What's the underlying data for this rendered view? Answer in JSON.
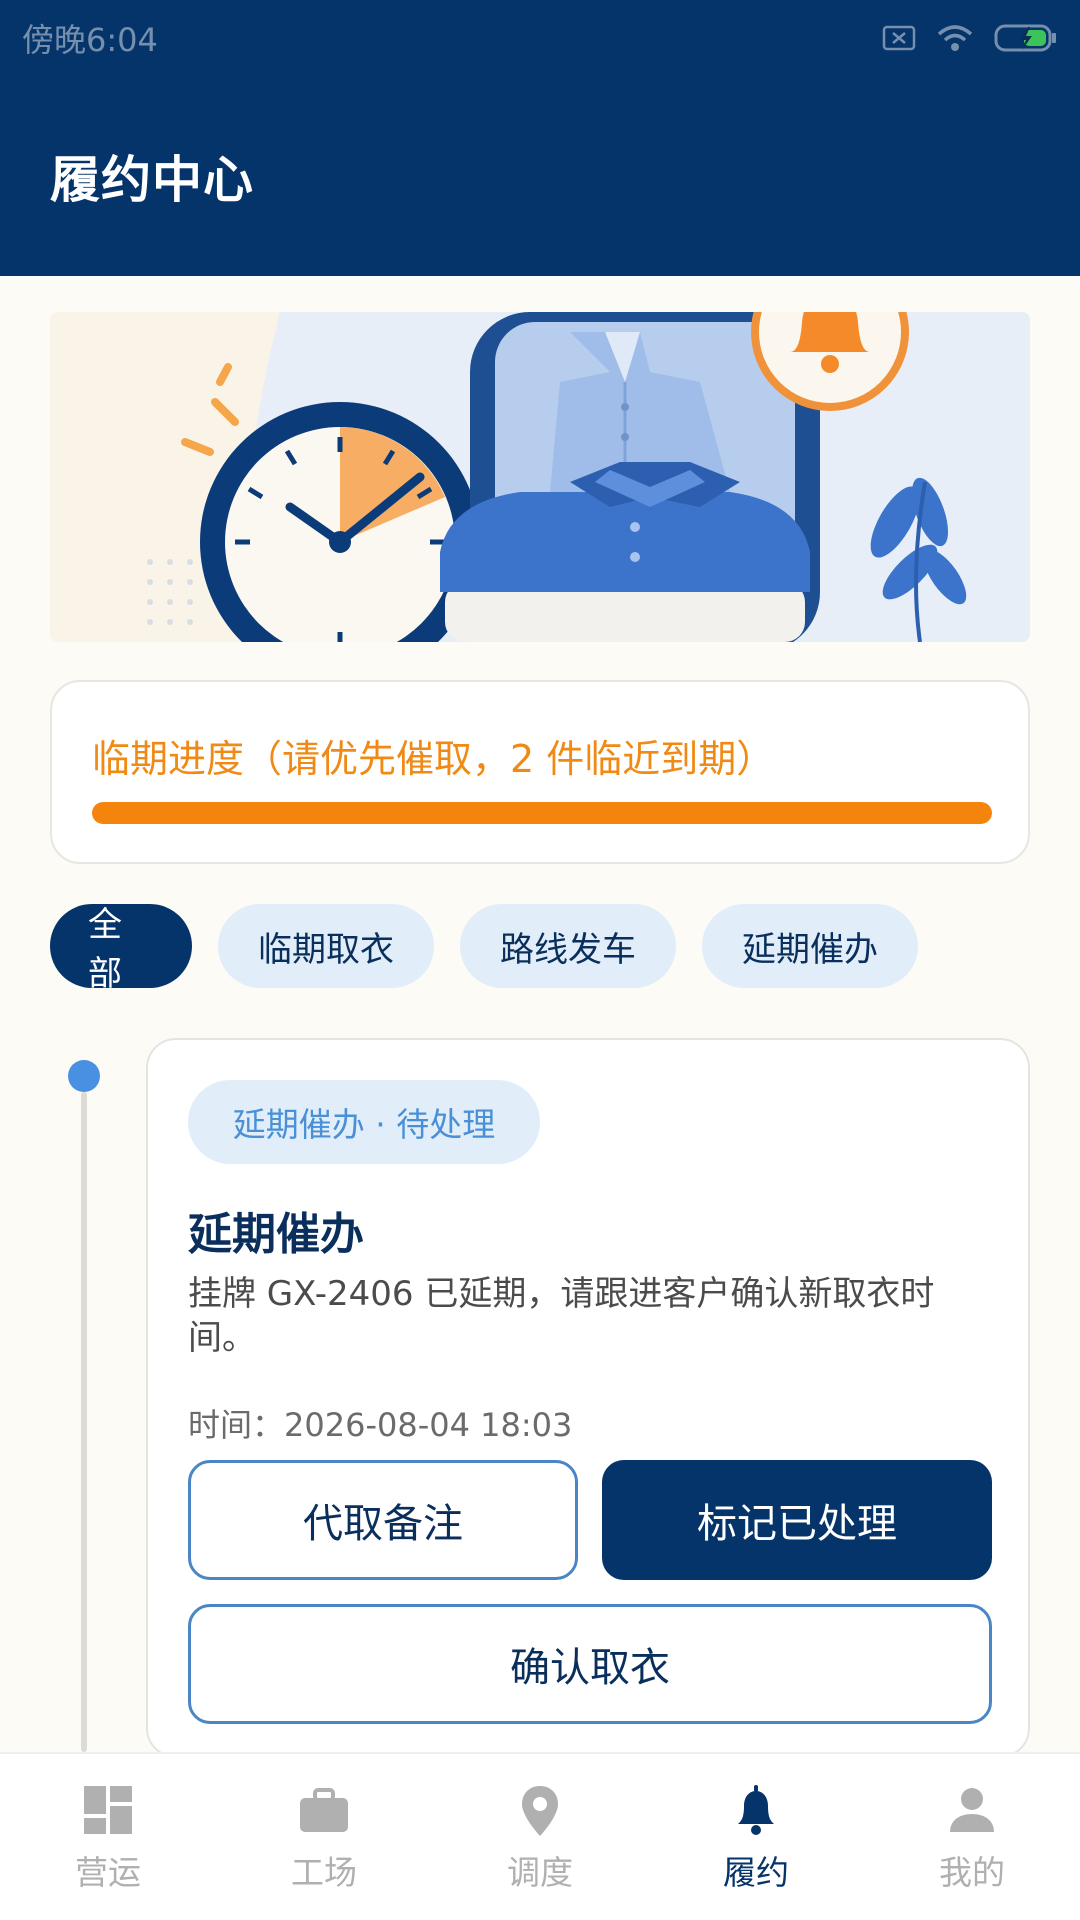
{
  "status_bar": {
    "time": "傍晚6:04"
  },
  "app_bar": {
    "title": "履约中心"
  },
  "progress": {
    "text": "临期进度（请优先催取，2 件临近到期）",
    "level": 1.0,
    "colors": {
      "track": "#f3dcc0",
      "fill": "#f5840c"
    }
  },
  "filters": [
    {
      "label": "全部",
      "active": true
    },
    {
      "label": "临期取衣",
      "active": false
    },
    {
      "label": "路线发车",
      "active": false
    },
    {
      "label": "延期催办",
      "active": false
    }
  ],
  "task": {
    "tag": "延期催办 · 待处理",
    "title": "延期催办",
    "description": "挂牌 GX-2406 已延期，请跟进客户确认新取衣时间。",
    "time": "时间：2026-08-04 18:03",
    "buttons": {
      "note": "代取备注",
      "mark_done": "标记已处理",
      "confirm": "确认取衣"
    }
  },
  "tabbar": [
    {
      "label": "营运",
      "icon": "dashboard-icon",
      "active": false
    },
    {
      "label": "工场",
      "icon": "briefcase-icon",
      "active": false
    },
    {
      "label": "调度",
      "icon": "location-pin-icon",
      "active": false
    },
    {
      "label": "履约",
      "icon": "bell-icon",
      "active": true
    },
    {
      "label": "我的",
      "icon": "person-icon",
      "active": false
    }
  ],
  "colors": {
    "primary": "#04346a",
    "accent": "#f5840c",
    "chip_bg": "#e1eefa",
    "timeline_dot": "#4a90e2"
  }
}
